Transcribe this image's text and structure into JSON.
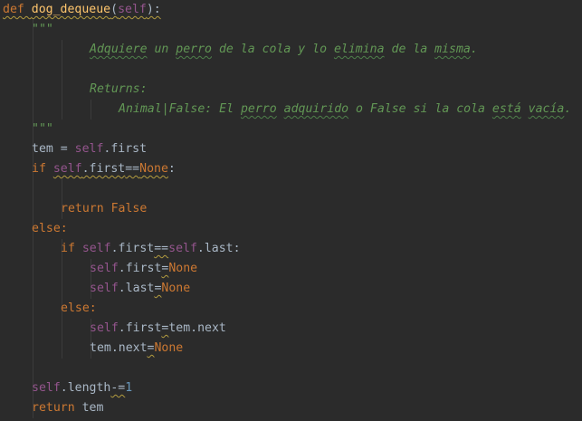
{
  "editor": {
    "colors": {
      "background": "#2b2b2b",
      "keyword": "#cc7832",
      "self": "#94558d",
      "function": "#ffc66d",
      "docstring": "#629755",
      "number": "#6897bb",
      "default": "#a9b7c6",
      "indent_guide": "#3b3b3b"
    },
    "lines": [
      {
        "indent": 0,
        "tokens": [
          {
            "text": "def ",
            "type": "keyword",
            "underline": "yellow"
          },
          {
            "text": "dog_dequeue",
            "type": "function",
            "underline": "yellow"
          },
          {
            "text": "(",
            "type": "default",
            "underline": "yellow"
          },
          {
            "text": "self",
            "type": "self",
            "underline": "yellow"
          },
          {
            "text": "):",
            "type": "default",
            "underline": "yellow"
          }
        ]
      },
      {
        "indent": 4,
        "tokens": [
          {
            "text": "\"\"\"",
            "type": "docstring"
          }
        ]
      },
      {
        "indent": 12,
        "tokens": [
          {
            "text": "Adquiere",
            "type": "docstring",
            "underline": "green"
          },
          {
            "text": " un ",
            "type": "docstring"
          },
          {
            "text": "perro",
            "type": "docstring",
            "underline": "green"
          },
          {
            "text": " de la cola y lo ",
            "type": "docstring"
          },
          {
            "text": "elimina",
            "type": "docstring",
            "underline": "green"
          },
          {
            "text": " de la ",
            "type": "docstring"
          },
          {
            "text": "misma",
            "type": "docstring",
            "underline": "green"
          },
          {
            "text": ".",
            "type": "docstring"
          }
        ]
      },
      {
        "indent": 0,
        "tokens": []
      },
      {
        "indent": 12,
        "tokens": [
          {
            "text": "Returns:",
            "type": "docstring"
          }
        ]
      },
      {
        "indent": 16,
        "tokens": [
          {
            "text": "Animal|False: El ",
            "type": "docstring"
          },
          {
            "text": "perro",
            "type": "docstring",
            "underline": "green"
          },
          {
            "text": " ",
            "type": "docstring"
          },
          {
            "text": "adquirido",
            "type": "docstring",
            "underline": "green"
          },
          {
            "text": " o False si la cola ",
            "type": "docstring"
          },
          {
            "text": "está",
            "type": "docstring",
            "underline": "green"
          },
          {
            "text": " ",
            "type": "docstring"
          },
          {
            "text": "vacía",
            "type": "docstring",
            "underline": "green"
          },
          {
            "text": ".",
            "type": "docstring"
          }
        ]
      },
      {
        "indent": 4,
        "tokens": [
          {
            "text": "\"\"\"",
            "type": "docstring"
          }
        ]
      },
      {
        "indent": 4,
        "tokens": [
          {
            "text": "tem = ",
            "type": "default"
          },
          {
            "text": "self",
            "type": "self"
          },
          {
            "text": ".first",
            "type": "default"
          }
        ]
      },
      {
        "indent": 4,
        "tokens": [
          {
            "text": "if ",
            "type": "keyword"
          },
          {
            "text": "self",
            "type": "self",
            "underline": "yellow"
          },
          {
            "text": ".first",
            "type": "default",
            "underline": "yellow"
          },
          {
            "text": "==",
            "type": "default",
            "underline": "yellow"
          },
          {
            "text": "None",
            "type": "keyword",
            "underline": "yellow"
          },
          {
            "text": ":",
            "type": "default"
          }
        ]
      },
      {
        "indent": 0,
        "tokens": []
      },
      {
        "indent": 8,
        "tokens": [
          {
            "text": "return ",
            "type": "keyword"
          },
          {
            "text": "False",
            "type": "keyword"
          }
        ]
      },
      {
        "indent": 4,
        "tokens": [
          {
            "text": "else:",
            "type": "keyword"
          }
        ]
      },
      {
        "indent": 8,
        "tokens": [
          {
            "text": "if ",
            "type": "keyword"
          },
          {
            "text": "self",
            "type": "self"
          },
          {
            "text": ".first",
            "type": "default"
          },
          {
            "text": "==",
            "type": "default",
            "underline": "yellow"
          },
          {
            "text": "self",
            "type": "self"
          },
          {
            "text": ".last:",
            "type": "default"
          }
        ]
      },
      {
        "indent": 12,
        "tokens": [
          {
            "text": "self",
            "type": "self"
          },
          {
            "text": ".first",
            "type": "default"
          },
          {
            "text": "=",
            "type": "default",
            "underline": "yellow"
          },
          {
            "text": "None",
            "type": "keyword"
          }
        ]
      },
      {
        "indent": 12,
        "tokens": [
          {
            "text": "self",
            "type": "self"
          },
          {
            "text": ".last",
            "type": "default"
          },
          {
            "text": "=",
            "type": "default",
            "underline": "yellow"
          },
          {
            "text": "None",
            "type": "keyword"
          }
        ]
      },
      {
        "indent": 8,
        "tokens": [
          {
            "text": "else:",
            "type": "keyword"
          }
        ]
      },
      {
        "indent": 12,
        "tokens": [
          {
            "text": "self",
            "type": "self"
          },
          {
            "text": ".first",
            "type": "default"
          },
          {
            "text": "=",
            "type": "default",
            "underline": "yellow"
          },
          {
            "text": "tem.next",
            "type": "default"
          }
        ]
      },
      {
        "indent": 12,
        "tokens": [
          {
            "text": "tem.next",
            "type": "default"
          },
          {
            "text": "=",
            "type": "default",
            "underline": "yellow"
          },
          {
            "text": "None",
            "type": "keyword"
          }
        ]
      },
      {
        "indent": 0,
        "tokens": []
      },
      {
        "indent": 4,
        "tokens": [
          {
            "text": "self",
            "type": "self"
          },
          {
            "text": ".length",
            "type": "default"
          },
          {
            "text": "-=",
            "type": "default",
            "underline": "yellow"
          },
          {
            "text": "1",
            "type": "number"
          }
        ]
      },
      {
        "indent": 4,
        "tokens": [
          {
            "text": "return ",
            "type": "keyword"
          },
          {
            "text": "tem",
            "type": "default"
          }
        ]
      }
    ]
  }
}
